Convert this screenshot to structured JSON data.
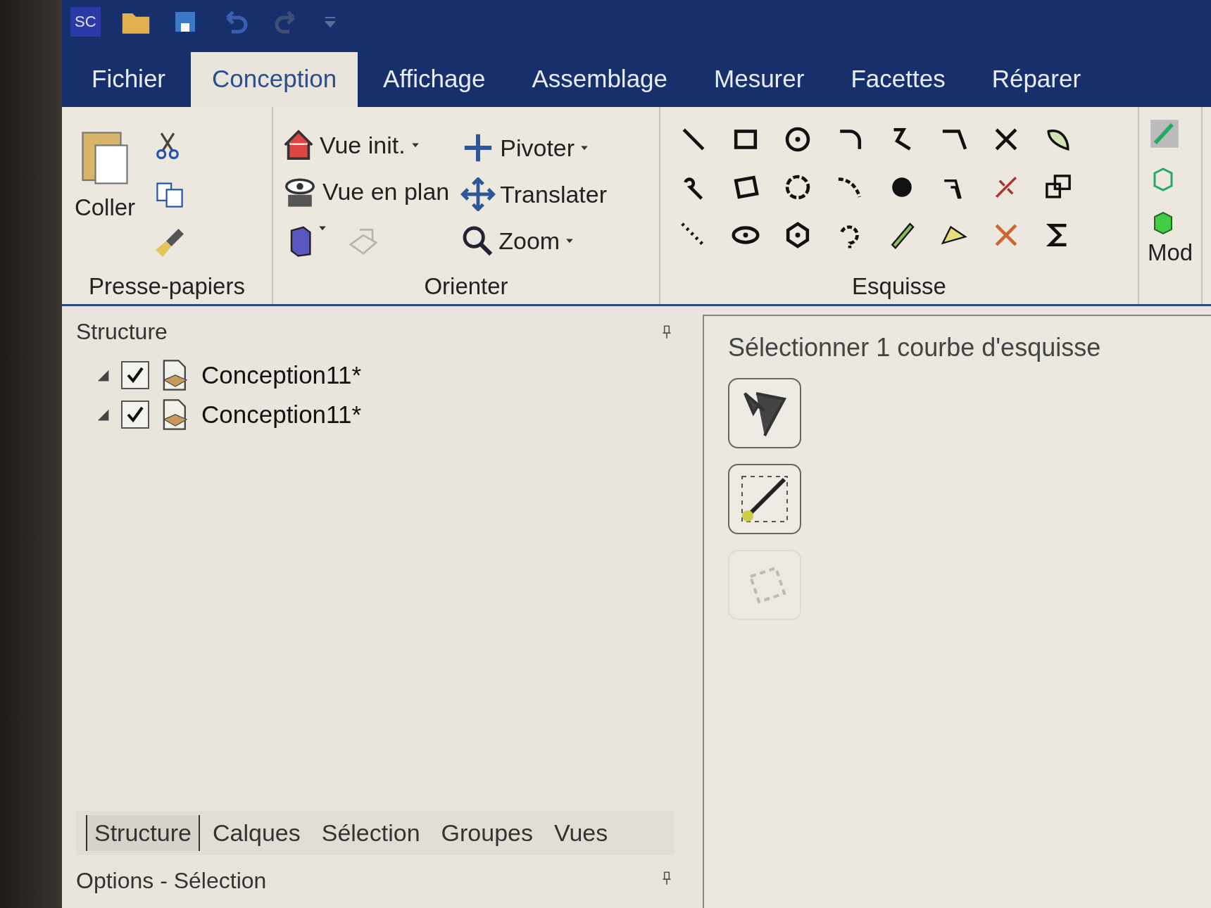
{
  "app_badge": "SC",
  "tabs": [
    {
      "label": "Fichier",
      "selected": false
    },
    {
      "label": "Conception",
      "selected": true
    },
    {
      "label": "Affichage",
      "selected": false
    },
    {
      "label": "Assemblage",
      "selected": false
    },
    {
      "label": "Mesurer",
      "selected": false
    },
    {
      "label": "Facettes",
      "selected": false
    },
    {
      "label": "Réparer",
      "selected": false
    }
  ],
  "clipboard": {
    "paste": "Coller",
    "group": "Presse-papiers"
  },
  "orient": {
    "group": "Orienter",
    "home": "Vue init.",
    "pivot": "Pivoter",
    "plan": "Vue en plan",
    "translate": "Translater",
    "zoom": "Zoom"
  },
  "sketch": {
    "group": "Esquisse"
  },
  "model": {
    "group": "Mod"
  },
  "structure": {
    "title": "Structure",
    "items": [
      {
        "label": "Conception11*",
        "checked": true,
        "expanded": true
      },
      {
        "label": "Conception11*",
        "checked": true,
        "expanded": true
      }
    ],
    "tabs": [
      {
        "label": "Structure",
        "selected": true
      },
      {
        "label": "Calques",
        "selected": false
      },
      {
        "label": "Sélection",
        "selected": false
      },
      {
        "label": "Groupes",
        "selected": false
      },
      {
        "label": "Vues",
        "selected": false
      }
    ],
    "options_title": "Options - Sélection"
  },
  "options_panel": {
    "title": "Sélectionner 1 courbe d'esquisse",
    "tools": [
      {
        "kind": "pick",
        "disabled": false
      },
      {
        "kind": "endpoint",
        "disabled": false
      },
      {
        "kind": "rotate",
        "disabled": true
      }
    ]
  }
}
